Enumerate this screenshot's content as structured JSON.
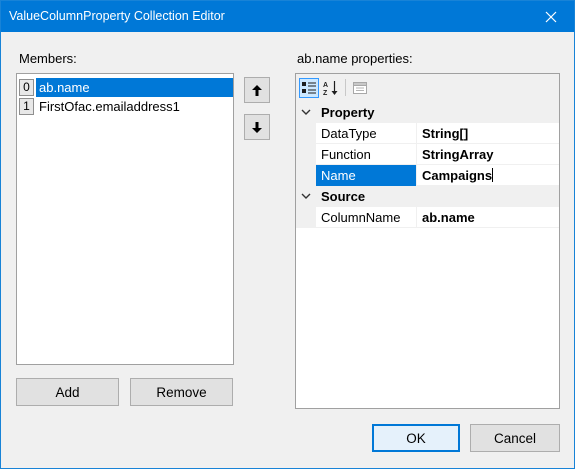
{
  "window": {
    "title": "ValueColumnProperty Collection Editor"
  },
  "members": {
    "label": "Members:",
    "items": [
      {
        "index": "0",
        "label": "ab.name",
        "selected": true
      },
      {
        "index": "1",
        "label": "FirstOfac.emailaddress1",
        "selected": false
      }
    ],
    "move_up_icon": "arrow-up-icon",
    "move_down_icon": "arrow-down-icon",
    "add_label": "Add",
    "remove_label": "Remove"
  },
  "properties": {
    "label": "ab.name properties:",
    "toolbar": {
      "categorized_icon": "categorized-icon",
      "alphabetical_icon": "alphabetical-icon",
      "property_pages_icon": "property-pages-icon"
    },
    "categories": [
      {
        "name": "Property",
        "rows": [
          {
            "name": "DataType",
            "value": "String[]"
          },
          {
            "name": "Function",
            "value": "StringArray"
          },
          {
            "name": "Name",
            "value": "Campaigns",
            "selected": true
          }
        ]
      },
      {
        "name": "Source",
        "rows": [
          {
            "name": "ColumnName",
            "value": "ab.name"
          }
        ]
      }
    ]
  },
  "footer": {
    "ok_label": "OK",
    "cancel_label": "Cancel"
  },
  "colors": {
    "title_bar": "#0078d7",
    "selection": "#0078d7",
    "dialog_bg": "#f0f0f0"
  }
}
